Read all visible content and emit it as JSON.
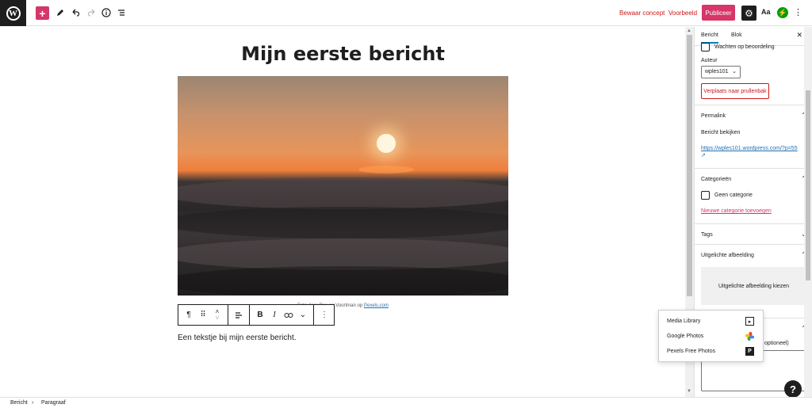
{
  "topbar": {
    "save_draft": "Bewaar concept",
    "preview": "Voorbeeld",
    "publish": "Publiceer",
    "aa": "Aa"
  },
  "editor": {
    "title": "Mijn eerste bericht",
    "caption_prefix": "Foto door Ray on Voortman op",
    "caption_link": "Pexels.com",
    "paragraph": "Een tekstje bij mijn eerste bericht."
  },
  "sidebar": {
    "tabs": [
      "Bericht",
      "Blok"
    ],
    "pending_review": "Wachten op beoordeling",
    "author_label": "Auteur",
    "author_value": "wples101",
    "trash_button": "Verplaats naar prullenbak",
    "permalink": {
      "title": "Permalink",
      "view_label": "Bericht bekijken",
      "url": "https://wples101.wordpress.com/?p=55"
    },
    "categories": {
      "title": "Categorieën",
      "none": "Geen categorie",
      "add_new": "Nieuwe categorie toevoegen"
    },
    "tags": {
      "title": "Tags"
    },
    "featured_image": {
      "title": "Uitgelichte afbeelding",
      "choose": "Uitgelichte afbeelding kiezen"
    },
    "excerpt_partial": "optioneel)"
  },
  "media_popover": {
    "items": [
      {
        "label": "Media Library",
        "icon": "play-square-icon"
      },
      {
        "label": "Google Photos",
        "icon": "pinwheel-icon"
      },
      {
        "label": "Pexels Free Photos",
        "icon": "pexels-icon"
      }
    ]
  },
  "footer": {
    "breadcrumb": [
      "Bericht",
      "Paragraaf"
    ]
  },
  "colors": {
    "accent": "#d63669",
    "link": "#2271b1",
    "danger": "#cc1818"
  }
}
